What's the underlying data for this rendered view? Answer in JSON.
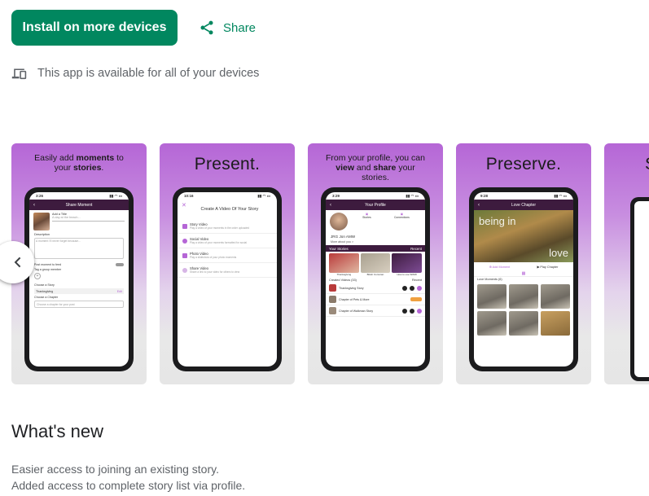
{
  "actions": {
    "install_label": "Install on more devices",
    "share_label": "Share"
  },
  "availability": {
    "text": "This app is available for all of your devices",
    "icon": "devices-icon"
  },
  "screenshots": [
    {
      "caption_pre": "Easily add ",
      "caption_bold1": "moments",
      "caption_mid": " to your ",
      "caption_bold2": "stories",
      "caption_post": ".",
      "phone": {
        "time": "3:26",
        "title": "Share Moment",
        "add_title": "Add a Title",
        "title_placeholder": "A day at the beach...",
        "description_label": "Description",
        "description_placeholder": "A moment I'll never forget because...",
        "post_label": "Post moment to feed",
        "tag_label": "Tag a group member",
        "choose_story": "Choose a Story",
        "story_value": "Thanksgiving",
        "edit": "Edit",
        "choose_chapter": "Choose a Chapter",
        "chapter_placeholder": "Choose a chapter for your post"
      }
    },
    {
      "big_caption": "Present.",
      "phone": {
        "time": "10:16",
        "heading": "Create A Video Of Your Story",
        "options": [
          {
            "title": "Story Video",
            "sub": "Play a video of your moments in the order uploaded"
          },
          {
            "title": "Social Video",
            "sub": "Play a video of your moments formatted for social"
          },
          {
            "title": "Photo Video",
            "sub": "Play a slideshow of your photo moments"
          },
          {
            "title": "Share Video",
            "sub": "Share a link to your video for others to view"
          }
        ]
      }
    },
    {
      "caption_pre": "From your profile, you can ",
      "caption_bold1": "view",
      "caption_mid": " and ",
      "caption_bold2": "share",
      "caption_post": " your stories.",
      "phone": {
        "time": "3:29",
        "title": "Your Profile",
        "name": "JRG Jon AMW",
        "more": "More about you >",
        "stats": [
          "Stories",
          "Connections"
        ],
        "stories_label": "Your Stories",
        "recent": "Recent",
        "story_thumbs": [
          "Thanksgiving",
          "Bitstir Corcoran",
          "How to use WWW"
        ],
        "created_label": "Created Videos (33)",
        "videos": [
          "Thanksgiving Story",
          "Chapter of Pets & More",
          "Chapter of Walkman Story"
        ]
      }
    },
    {
      "big_caption": "Preserve.",
      "phone": {
        "time": "9:28",
        "title": "Love Chapter",
        "hero_text_1": "being in",
        "hero_text_2": "love",
        "add_moment": "Add Moment",
        "play_chapter": "Play Chapter",
        "moments_label": "Love Moments (6)"
      }
    },
    {
      "big_caption": "S"
    }
  ],
  "carousel": {
    "prev_icon": "chevron-left-icon"
  },
  "whats_new": {
    "heading": "What's new",
    "lines": [
      "Easier access to joining an existing story.",
      "Added access to complete story list via profile."
    ]
  },
  "colors": {
    "accent": "#01875f",
    "brand_purple": "#3d1b3e",
    "screenshot_gradient_top": "#b566d6"
  }
}
